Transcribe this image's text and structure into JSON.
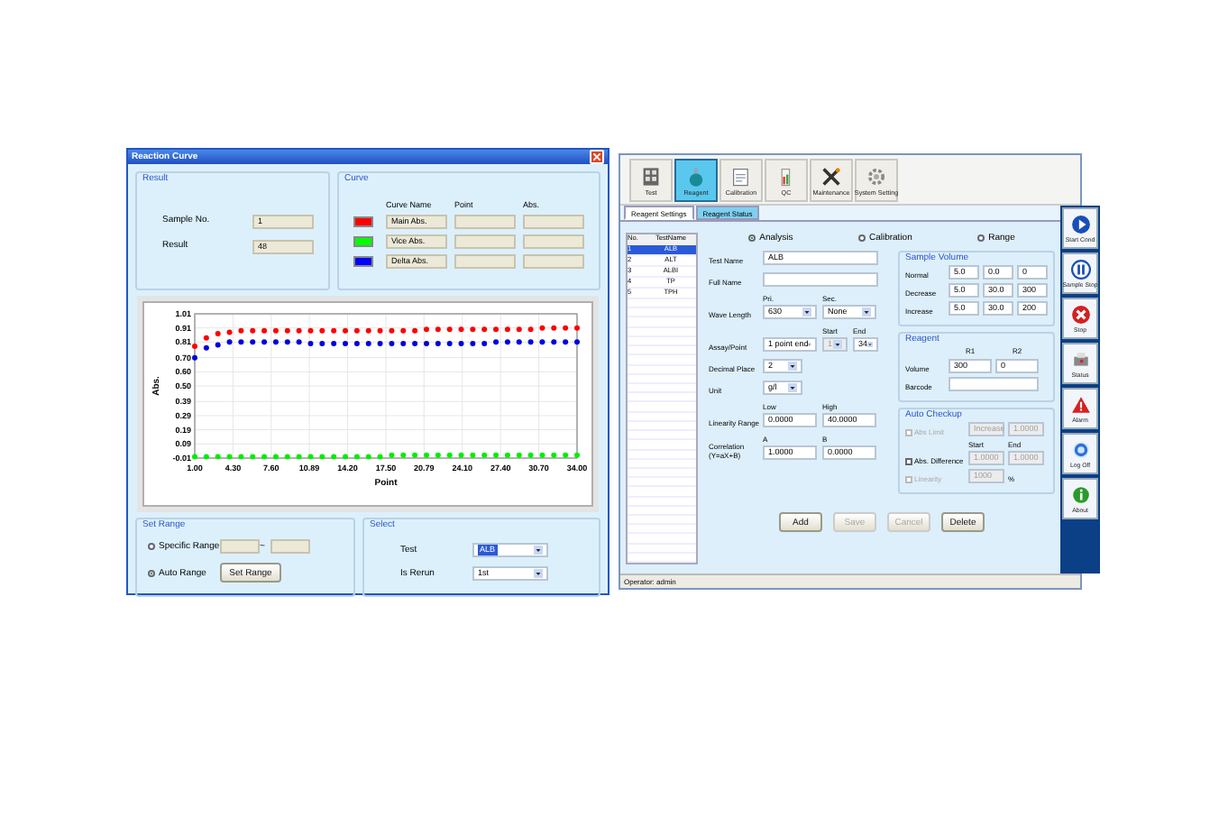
{
  "reaction_curve_window": {
    "title": "Reaction Curve",
    "result_group": {
      "title": "Result",
      "fields": [
        {
          "label": "Sample No.",
          "value": "1"
        },
        {
          "label": "Result",
          "value": "48"
        }
      ]
    },
    "curve_group": {
      "title": "Curve",
      "columns": [
        "Curve Name",
        "Point",
        "Abs."
      ],
      "rows": [
        {
          "name": "Main Abs.",
          "color": "#ff0000"
        },
        {
          "name": "Vice Abs.",
          "color": "#00ff00"
        },
        {
          "name": "Delta Abs.",
          "color": "#0000ff"
        }
      ]
    },
    "chart_data": {
      "type": "scatter",
      "grid": true,
      "xlabel": "Point",
      "ylabel": "Abs.",
      "x": [
        1,
        2,
        3,
        4,
        5,
        6,
        7,
        8,
        9,
        10,
        11,
        12,
        13,
        14,
        15,
        16,
        17,
        18,
        19,
        20,
        21,
        22,
        23,
        24,
        25,
        26,
        27,
        28,
        29,
        30,
        31,
        32,
        33,
        34
      ],
      "series": [
        {
          "color": "#ff0000",
          "values": [
            0.78,
            0.84,
            0.87,
            0.88,
            0.89,
            0.89,
            0.89,
            0.89,
            0.89,
            0.89,
            0.89,
            0.89,
            0.89,
            0.89,
            0.89,
            0.89,
            0.89,
            0.89,
            0.89,
            0.89,
            0.9,
            0.9,
            0.9,
            0.9,
            0.9,
            0.9,
            0.9,
            0.9,
            0.9,
            0.9,
            0.91,
            0.91,
            0.91,
            0.91
          ]
        },
        {
          "color": "#00ee00",
          "values": [
            0.0,
            0.0,
            0.0,
            0.0,
            0.0,
            0.0,
            0.0,
            0.0,
            0.0,
            0.0,
            0.0,
            0.0,
            0.0,
            0.0,
            0.0,
            0.0,
            0.0,
            0.01,
            0.01,
            0.01,
            0.01,
            0.01,
            0.01,
            0.01,
            0.01,
            0.01,
            0.01,
            0.01,
            0.01,
            0.01,
            0.01,
            0.01,
            0.01,
            0.01
          ]
        },
        {
          "color": "#0000dd",
          "values": [
            0.7,
            0.77,
            0.79,
            0.81,
            0.81,
            0.81,
            0.81,
            0.81,
            0.81,
            0.81,
            0.8,
            0.8,
            0.8,
            0.8,
            0.8,
            0.8,
            0.8,
            0.8,
            0.8,
            0.8,
            0.8,
            0.8,
            0.8,
            0.8,
            0.8,
            0.8,
            0.81,
            0.81,
            0.81,
            0.81,
            0.81,
            0.81,
            0.81,
            0.81
          ]
        }
      ],
      "xlim": [
        1,
        34
      ],
      "ylim": [
        -0.01,
        1.01
      ],
      "xticks": [
        {
          "value": 1,
          "label": "1.00"
        },
        {
          "value": 4.3,
          "label": "4.30"
        },
        {
          "value": 7.6,
          "label": "7.60"
        },
        {
          "value": 10.89,
          "label": "10.89"
        },
        {
          "value": 14.2,
          "label": "14.20"
        },
        {
          "value": 17.5,
          "label": "17.50"
        },
        {
          "value": 20.79,
          "label": "20.79"
        },
        {
          "value": 24.1,
          "label": "24.10"
        },
        {
          "value": 27.4,
          "label": "27.40"
        },
        {
          "value": 30.7,
          "label": "30.70"
        },
        {
          "value": 34,
          "label": "34.00"
        }
      ],
      "yticks": [
        {
          "value": 1.01,
          "label": "1.01"
        },
        {
          "value": 0.91,
          "label": "0.91"
        },
        {
          "value": 0.81,
          "label": "0.81"
        },
        {
          "value": 0.7,
          "label": "0.70"
        },
        {
          "value": 0.6,
          "label": "0.60"
        },
        {
          "value": 0.5,
          "label": "0.50"
        },
        {
          "value": 0.39,
          "label": "0.39"
        },
        {
          "value": 0.29,
          "label": "0.29"
        },
        {
          "value": 0.19,
          "label": "0.19"
        },
        {
          "value": 0.09,
          "label": "0.09"
        },
        {
          "value": -0.01,
          "label": "-0.01"
        }
      ]
    },
    "set_range": {
      "title": "Set Range",
      "options": [
        {
          "label": "Specific Range",
          "selected": false
        },
        {
          "label": "Auto Range",
          "selected": true
        }
      ],
      "separator": "~",
      "button": "Set Range"
    },
    "select_group": {
      "title": "Select",
      "fields": [
        {
          "label": "Test",
          "value": "ALB",
          "focused": true
        },
        {
          "label": "Is Rerun",
          "value": "1st",
          "focused": false
        }
      ]
    }
  },
  "reagent_window": {
    "toolbar": [
      {
        "label": "Test",
        "selected": false
      },
      {
        "label": "Reagent",
        "selected": true
      },
      {
        "label": "Calibration",
        "selected": false
      },
      {
        "label": "QC",
        "selected": false
      },
      {
        "label": "Maintenance",
        "selected": false
      },
      {
        "label": "System Setting",
        "selected": false
      }
    ],
    "subtabs": [
      {
        "label": "Reagent Settings",
        "selected": true
      },
      {
        "label": "Reagent Status",
        "selected": false
      }
    ],
    "test_list": {
      "columns": [
        "No.",
        "TestName"
      ],
      "rows": [
        {
          "no": "1",
          "name": "ALB",
          "selected": true
        },
        {
          "no": "2",
          "name": "ALT",
          "selected": false
        },
        {
          "no": "3",
          "name": "ALBI",
          "selected": false
        },
        {
          "no": "4",
          "name": "TP",
          "selected": false
        },
        {
          "no": "5",
          "name": "TPH",
          "selected": false
        }
      ]
    },
    "mode_options": [
      {
        "label": "Analysis",
        "selected": true
      },
      {
        "label": "Calibration",
        "selected": false
      },
      {
        "label": "Range",
        "selected": false
      }
    ],
    "form_rows": [
      {
        "label": "Test Name",
        "fields": [
          {
            "kind": "text",
            "value": "ALB",
            "disabled": false
          }
        ]
      },
      {
        "label": "Full Name",
        "fields": [
          {
            "kind": "text",
            "disabled": false
          }
        ]
      },
      {
        "label": "Wave Length",
        "fields": [
          {
            "kind": "select",
            "header": "Pri.",
            "value": "630",
            "disabled": false
          },
          {
            "kind": "select",
            "header": "Sec.",
            "value": "None",
            "disabled": false
          }
        ]
      },
      {
        "label": "Assay/Point",
        "fields": [
          {
            "kind": "select",
            "value": "1 point end",
            "disabled": false
          },
          {
            "kind": "select",
            "header": "Start",
            "value": "1",
            "disabled": true
          },
          {
            "kind": "select",
            "header": "End",
            "value": "34",
            "disabled": false
          }
        ]
      },
      {
        "label": "Decimal Place",
        "fields": [
          {
            "kind": "select",
            "value": "2",
            "disabled": false
          }
        ]
      },
      {
        "label": "Unit",
        "fields": [
          {
            "kind": "select",
            "value": "g/l",
            "disabled": false
          }
        ]
      },
      {
        "label": "Linearity Range",
        "fields": [
          {
            "kind": "text",
            "header": "Low",
            "value": "0.0000",
            "disabled": false
          },
          {
            "kind": "text",
            "header": "High",
            "value": "40.0000",
            "disabled": false
          }
        ]
      },
      {
        "label": "Correlation (Y=aX+B)",
        "fields": [
          {
            "kind": "text",
            "header": "A",
            "value": "1.0000",
            "disabled": false
          },
          {
            "kind": "text",
            "header": "B",
            "value": "0.0000",
            "disabled": false
          }
        ]
      }
    ],
    "sample_volume": {
      "title": "Sample Volume",
      "rows": [
        {
          "label": "Normal",
          "values": [
            "5.0",
            "0.0",
            "0"
          ]
        },
        {
          "label": "Decrease",
          "values": [
            "5.0",
            "30.0",
            "300"
          ]
        },
        {
          "label": "Increase",
          "values": [
            "5.0",
            "30.0",
            "200"
          ]
        }
      ]
    },
    "reagent": {
      "title": "Reagent",
      "columns": [
        "R1",
        "R2"
      ],
      "rows": [
        {
          "label": "Volume",
          "values": [
            "300",
            "0"
          ]
        },
        {
          "label": "Barcode",
          "values": []
        }
      ]
    },
    "auto_checkup": {
      "title": "Auto Checkup",
      "rows": [
        {
          "label": "Abs Limit",
          "checked": false,
          "disabled": true,
          "fields": [
            {
              "kind": "select",
              "value": "Increase",
              "disabled": true
            },
            {
              "kind": "text",
              "value": "1.0000",
              "disabled": true
            }
          ]
        },
        {
          "label": "Abs. Difference",
          "checked": false,
          "disabled": false,
          "fields": [
            {
              "kind": "text",
              "header": "Start",
              "value": "1.0000",
              "disabled": true
            },
            {
              "kind": "text",
              "header": "End",
              "value": "1.0000",
              "disabled": true
            }
          ]
        },
        {
          "label": "Linearity",
          "checked": false,
          "disabled": true,
          "fields": [
            {
              "kind": "text",
              "value": "1000",
              "disabled": true
            }
          ],
          "suffix": "%"
        }
      ]
    },
    "buttons": [
      {
        "label": "Add",
        "disabled": false
      },
      {
        "label": "Save",
        "disabled": true
      },
      {
        "label": "Cancel",
        "disabled": true
      },
      {
        "label": "Delete",
        "disabled": false
      }
    ],
    "side_buttons": [
      {
        "label": "Start Cond"
      },
      {
        "label": "Sample Stop"
      },
      {
        "label": "Stop"
      },
      {
        "label": "Status"
      },
      {
        "label": "Alarm"
      },
      {
        "label": "Log Off"
      },
      {
        "label": "About"
      }
    ],
    "status_bar": "Operator: admin"
  }
}
